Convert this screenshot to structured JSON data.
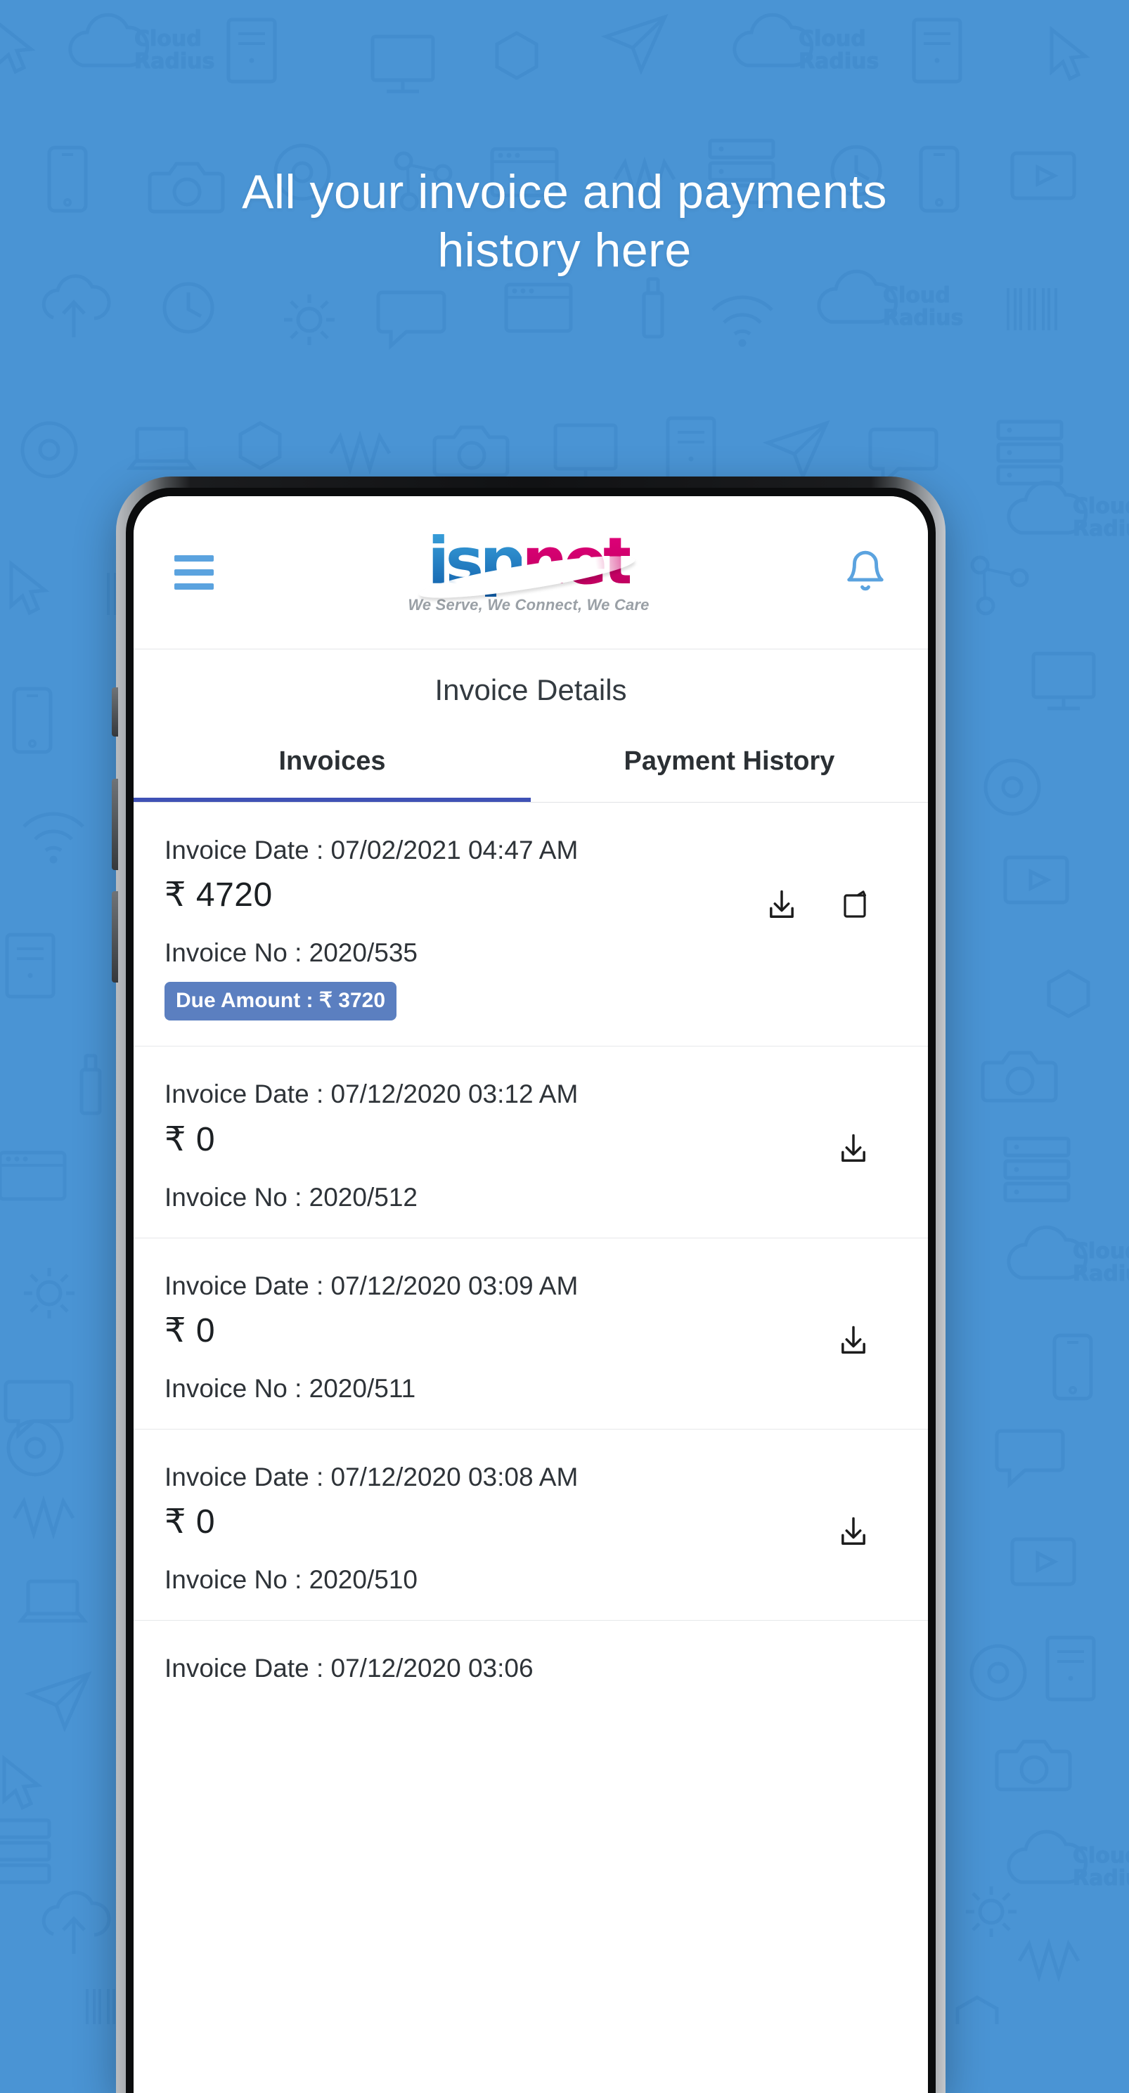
{
  "promo": {
    "headline_line1": "All your invoice and payments",
    "headline_line2": "history here",
    "background_color": "#4a94d4",
    "headline_color": "#ffffff"
  },
  "app": {
    "header": {
      "menu_icon": "hamburger-menu-icon",
      "notification_icon": "bell-icon",
      "icon_color": "#5ba3df",
      "logo": {
        "text_primary": "isp",
        "text_secondary": "net",
        "primary_color": "#1769b3",
        "secondary_color": "#d6006e",
        "tagline": "We Serve, We Connect, We Care"
      }
    },
    "page_title": "Invoice Details",
    "tabs": [
      {
        "label": "Invoices",
        "active": true
      },
      {
        "label": "Payment History",
        "active": false
      }
    ],
    "tab_indicator_color": "#3f51b5",
    "currency_symbol": "₹",
    "labels": {
      "invoice_date": "Invoice Date :",
      "invoice_no": "Invoice No :",
      "due_amount": "Due Amount :"
    },
    "badge_color": "#5b7fc0",
    "invoices": [
      {
        "date_text": "Invoice Date : 07/02/2021 04:47 AM",
        "amount_text": "₹ 4720",
        "invoice_no_text": "Invoice No : 2020/535",
        "due_badge_text": "Due Amount : ₹ 3720",
        "has_due": true,
        "actions": [
          "download-icon",
          "pay-card-icon"
        ]
      },
      {
        "date_text": "Invoice Date : 07/12/2020 03:12 AM",
        "amount_text": "₹ 0",
        "invoice_no_text": "Invoice No : 2020/512",
        "due_badge_text": "",
        "has_due": false,
        "actions": [
          "download-icon"
        ]
      },
      {
        "date_text": "Invoice Date : 07/12/2020 03:09 AM",
        "amount_text": "₹ 0",
        "invoice_no_text": "Invoice No : 2020/511",
        "due_badge_text": "",
        "has_due": false,
        "actions": [
          "download-icon"
        ]
      },
      {
        "date_text": "Invoice Date : 07/12/2020 03:08 AM",
        "amount_text": "₹ 0",
        "invoice_no_text": "Invoice No : 2020/510",
        "due_badge_text": "",
        "has_due": false,
        "actions": [
          "download-icon"
        ]
      },
      {
        "date_text": "Invoice Date : 07/12/2020 03:06",
        "amount_text": "",
        "invoice_no_text": "",
        "due_badge_text": "",
        "has_due": false,
        "partial": true,
        "actions": []
      }
    ]
  }
}
